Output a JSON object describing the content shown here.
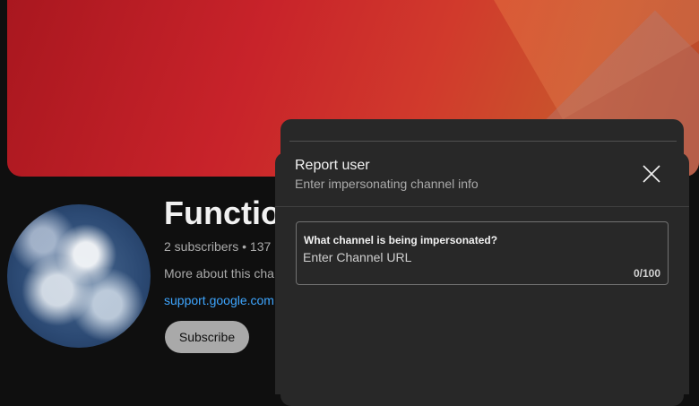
{
  "channel": {
    "name": "Function",
    "meta": "2 subscribers • 137 ",
    "about": "More about this cha",
    "link": "support.google.com",
    "subscribe_label": "Subscribe"
  },
  "dialog": {
    "title": "Report user",
    "subtitle": "Enter impersonating channel info",
    "close_icon": "close-icon",
    "field": {
      "label": "What channel is being impersonated?",
      "placeholder": "Enter Channel URL",
      "value": "",
      "counter": "0/100"
    }
  },
  "colors": {
    "background": "#0f0f0f",
    "dialog": "#282828",
    "link": "#3ea6ff",
    "subscribe_button": "#a9a9a9"
  }
}
